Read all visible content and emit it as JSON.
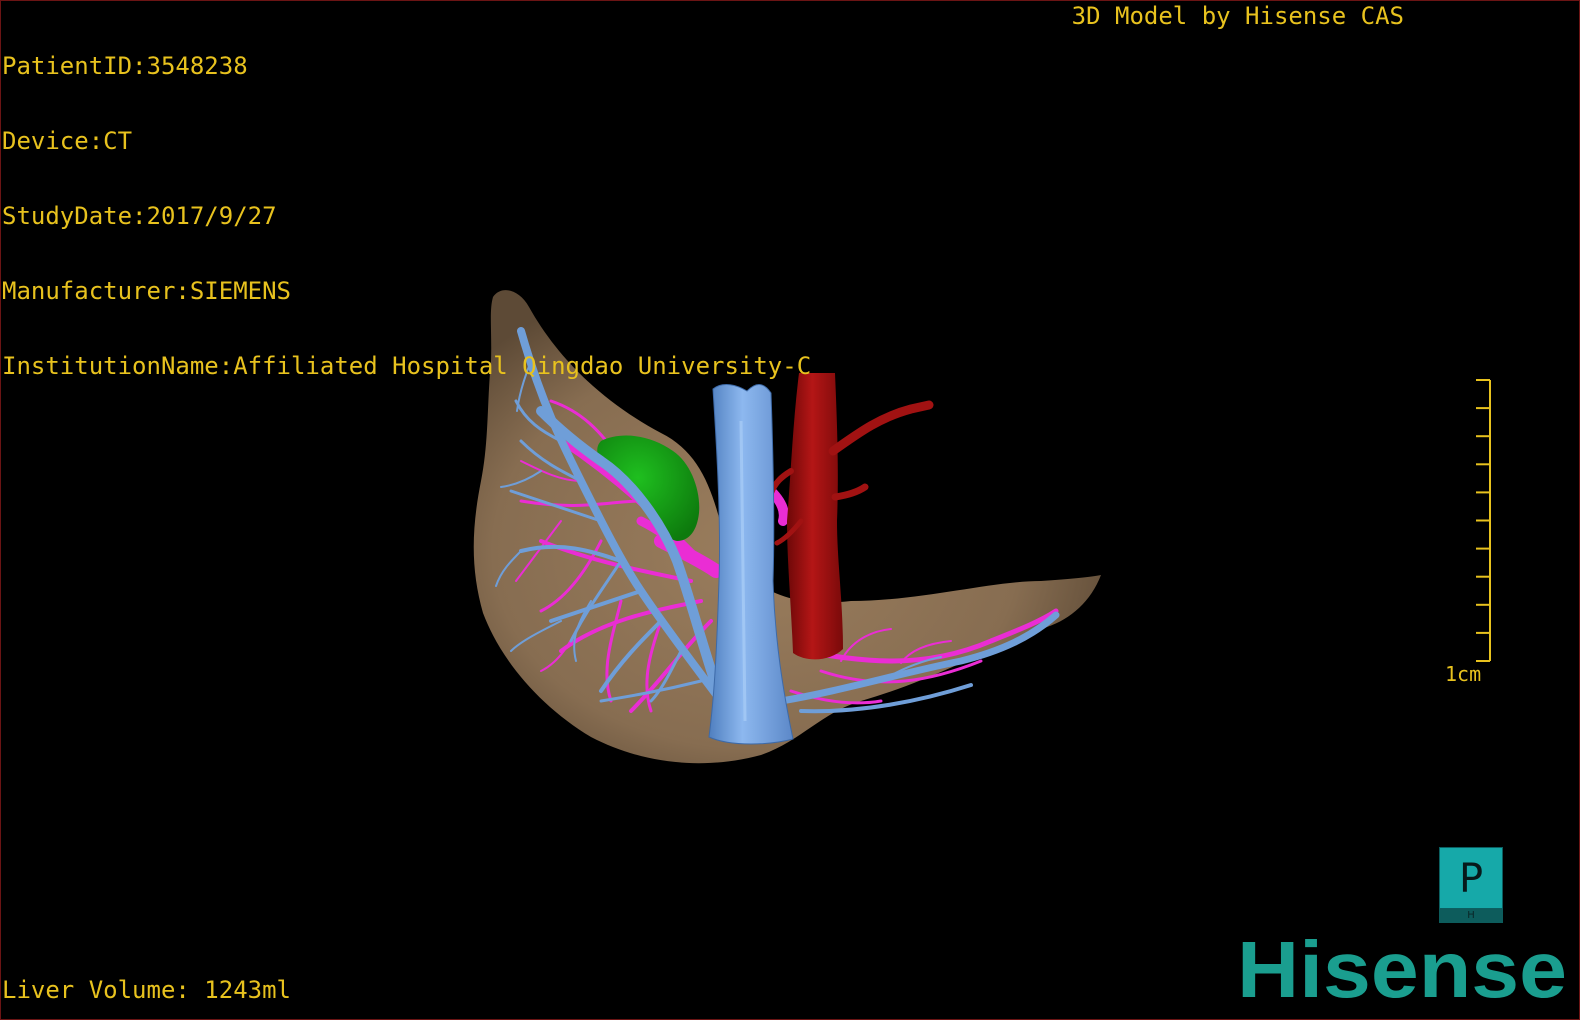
{
  "dicom_info": {
    "patient_id": "PatientID:3548238",
    "device": "Device:CT",
    "study_date": "StudyDate:2017/9/27",
    "manufacturer": "Manufacturer:SIEMENS",
    "institution": "InstitutionName:Affiliated Hospital Qingdao University-C"
  },
  "credit": "3D Model by Hisense CAS",
  "liver_volume": "Liver Volume: 1243ml",
  "scale": {
    "label": "1cm",
    "ticks": 11
  },
  "orientation": {
    "face": "P",
    "bottom": "H"
  },
  "brand": {
    "name": "Hisense",
    "color": "#1a9e8f"
  },
  "colors": {
    "text": "#e8c21e",
    "liver": "#876d51",
    "portal_vein": "#6f9ed8",
    "hepatic_vein": "#ea2dd4",
    "artery": "#9b0f0f",
    "gallbladder": "#159a15"
  },
  "structures": [
    {
      "name": "liver",
      "color": "liver"
    },
    {
      "name": "inferior vena cava / portal vein",
      "color": "portal_vein"
    },
    {
      "name": "hepatic vein",
      "color": "hepatic_vein"
    },
    {
      "name": "aorta / artery",
      "color": "artery"
    },
    {
      "name": "gallbladder",
      "color": "gallbladder"
    }
  ]
}
